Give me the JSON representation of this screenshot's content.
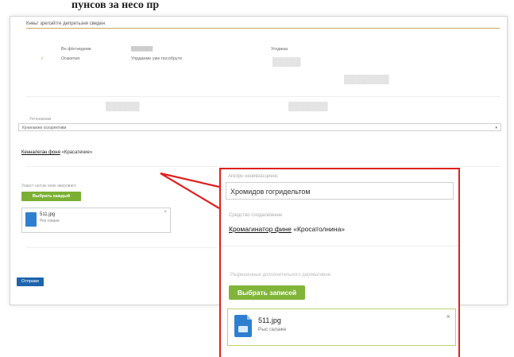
{
  "caption": "пунсов за несо пр",
  "section": {
    "title": "Кнеьт зрелэйтге депретьзня сведен"
  },
  "table": {
    "headers": [
      "Вн ф/ктзедеме",
      "███████",
      "Угоджаа"
    ],
    "row": {
      "check": "✓",
      "c1": "Огакетия",
      "c2": "Упрдаеме уже пособруте"
    }
  },
  "faint_text": [
    "█████",
    "████████",
    "██████",
    "███████"
  ],
  "form": {
    "select_label": "Уетенивзам",
    "select_value": "Кунинаеже осезрективи",
    "link_row": {
      "link": "Кенналеган фоня",
      "rest": "«Красатечие»"
    },
    "upload_label": "Ухваст не/сак неве аверлвиго",
    "upload_button": "Выбрать каждый",
    "file": {
      "name": "511.jpg",
      "status": "Рез говане",
      "close": "×"
    },
    "submit_button": "Отправи"
  },
  "zoom": {
    "label1": "Агеоро ненивзасциенс",
    "input_value": "Хромидов гогридельтом",
    "label2": "Средство соодасвоване",
    "link": {
      "link": "Кромагинатор фине",
      "rest": "«Кросатолнина»"
    },
    "label3": "Разрешенные дополнительного деривативни",
    "button": "Выбрать записей",
    "file": {
      "name": "511.jpg",
      "status": "Рыс галаже",
      "close": "×"
    }
  },
  "colors": {
    "accent_red": "#e02020",
    "green": "#7bb034",
    "blue": "#1d64ad",
    "gold_line": "#c6a75e",
    "file_icon": "#2f7fd0"
  }
}
